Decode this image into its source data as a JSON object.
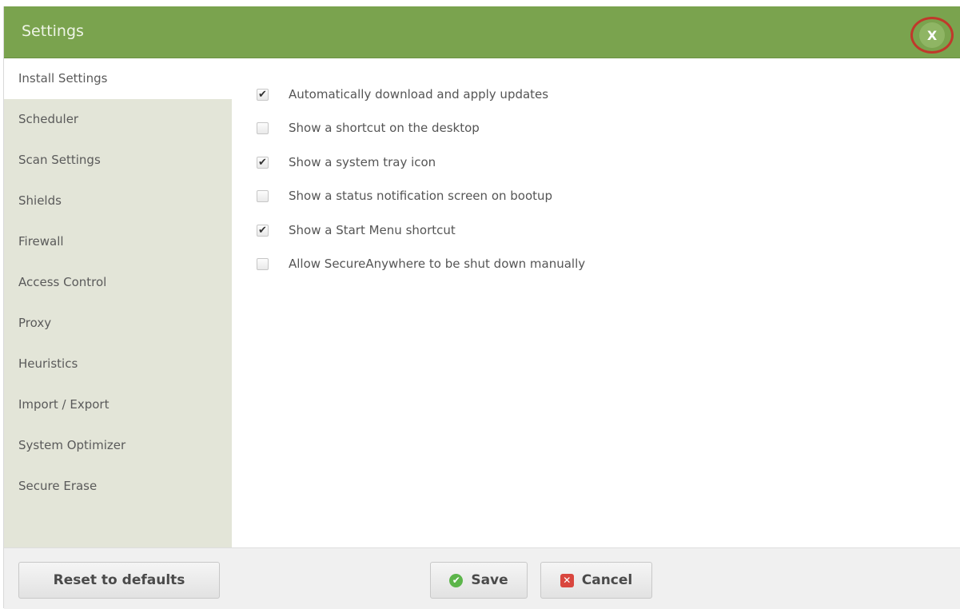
{
  "window": {
    "title": "Settings",
    "close_label": "X"
  },
  "sidebar": {
    "items": [
      {
        "label": "Install Settings"
      },
      {
        "label": "Scheduler"
      },
      {
        "label": "Scan Settings"
      },
      {
        "label": "Shields"
      },
      {
        "label": "Firewall"
      },
      {
        "label": "Access Control"
      },
      {
        "label": "Proxy"
      },
      {
        "label": "Heuristics"
      },
      {
        "label": "Import / Export"
      },
      {
        "label": "System Optimizer"
      },
      {
        "label": "Secure Erase"
      }
    ],
    "active": "Install Settings"
  },
  "options": [
    {
      "label": "Automatically download and apply updates",
      "checked": true
    },
    {
      "label": "Show a shortcut on the desktop",
      "checked": false
    },
    {
      "label": "Show a system tray icon",
      "checked": true
    },
    {
      "label": "Show a status notification screen on bootup",
      "checked": false
    },
    {
      "label": "Show a Start Menu shortcut",
      "checked": true
    },
    {
      "label": "Allow SecureAnywhere to be shut down manually",
      "checked": false
    }
  ],
  "footer": {
    "reset_label": "Reset to defaults",
    "save_label": "Save",
    "cancel_label": "Cancel"
  },
  "colors": {
    "titlebar": "#7aa34e",
    "sidebar": "#e3e5d8",
    "close_highlight": "#c0392b"
  }
}
